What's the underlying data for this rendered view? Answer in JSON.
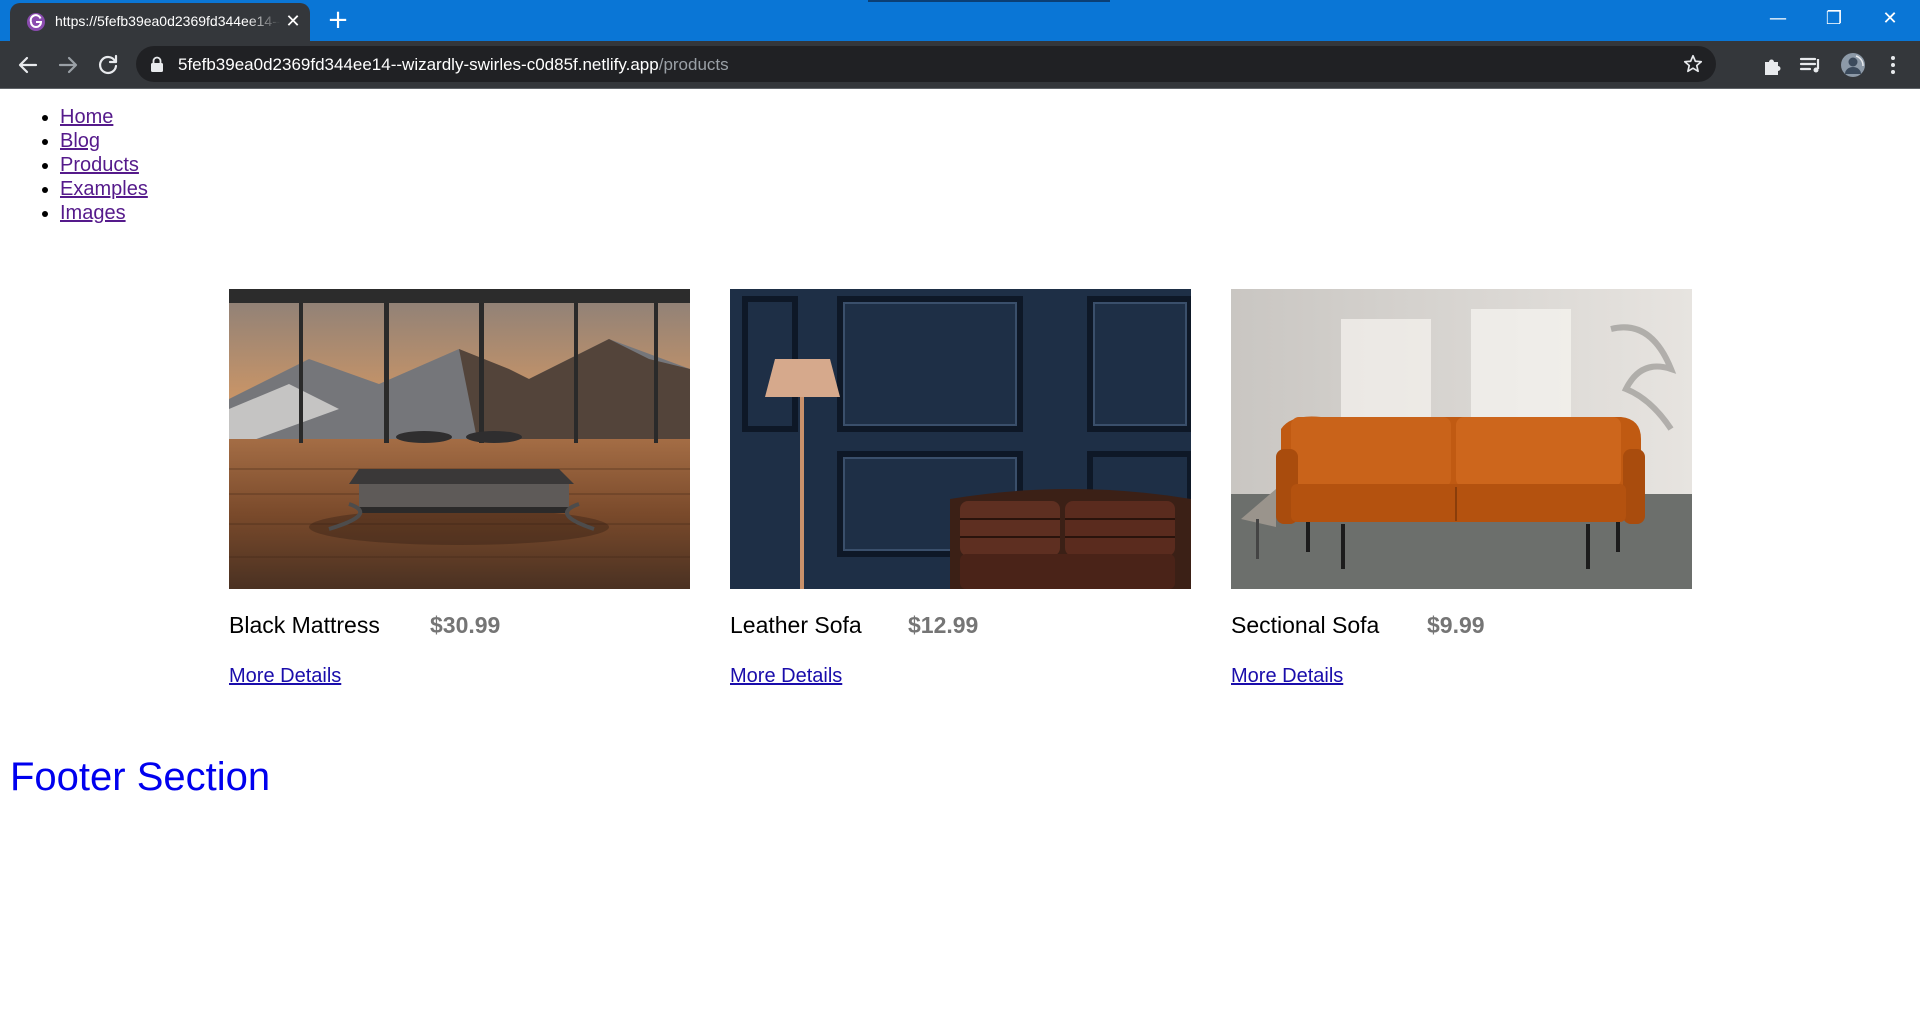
{
  "browser": {
    "tab_title": "https://5fefb39ea0d2369fd344ee14--wizardly-swirles-c0d85f.netlify.app/products",
    "url_host": "5fefb39ea0d2369fd344ee14--wizardly-swirles-c0d85f.netlify.app",
    "url_path": "/products",
    "tab_close": "✕",
    "new_tab": "+",
    "window_controls": {
      "minimize": "—",
      "restore": "❐",
      "close": "✕"
    },
    "colors": {
      "titlebar": "#0a76d6",
      "toolbar": "#34373b",
      "omnibox": "#202124"
    }
  },
  "nav": {
    "items": [
      {
        "label": "Home"
      },
      {
        "label": "Blog"
      },
      {
        "label": "Products"
      },
      {
        "label": "Examples"
      },
      {
        "label": "Images"
      }
    ]
  },
  "products": [
    {
      "name": "Black Mattress",
      "price": "$30.99",
      "details_label": "More Details",
      "image": "bed-on-wooden-floor-mountain-view"
    },
    {
      "name": "Leather Sofa",
      "price": "$12.99",
      "details_label": "More Details",
      "image": "leather-sofa-dark-panel-wall-with-lamp"
    },
    {
      "name": "Sectional Sofa",
      "price": "$9.99",
      "details_label": "More Details",
      "image": "orange-leather-sofa-sunlit-room"
    }
  ],
  "footer": {
    "heading": "Footer Section"
  }
}
